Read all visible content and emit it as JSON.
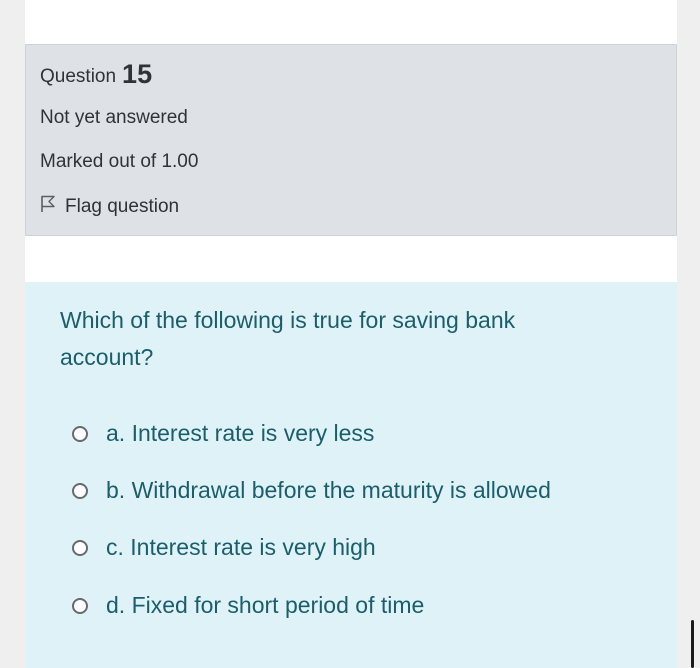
{
  "question": {
    "label": "Question",
    "number": "15",
    "status": "Not yet answered",
    "marks": "Marked out of 1.00",
    "flag_label": "Flag question"
  },
  "content": {
    "question_text": "Which of the following is true for saving bank account?",
    "answers": [
      {
        "label": "a. Interest rate is very less"
      },
      {
        "label": "b. Withdrawal before the maturity is allowed"
      },
      {
        "label": "c. Interest rate is very high"
      },
      {
        "label": "d. Fixed for short period of time"
      }
    ]
  },
  "colors": {
    "info_bg": "#dee2e6",
    "content_bg": "#def2f8",
    "question_text": "#1b5e6b"
  },
  "icons": {
    "flag": "flag-icon",
    "radio": "radio-unchecked-icon"
  }
}
